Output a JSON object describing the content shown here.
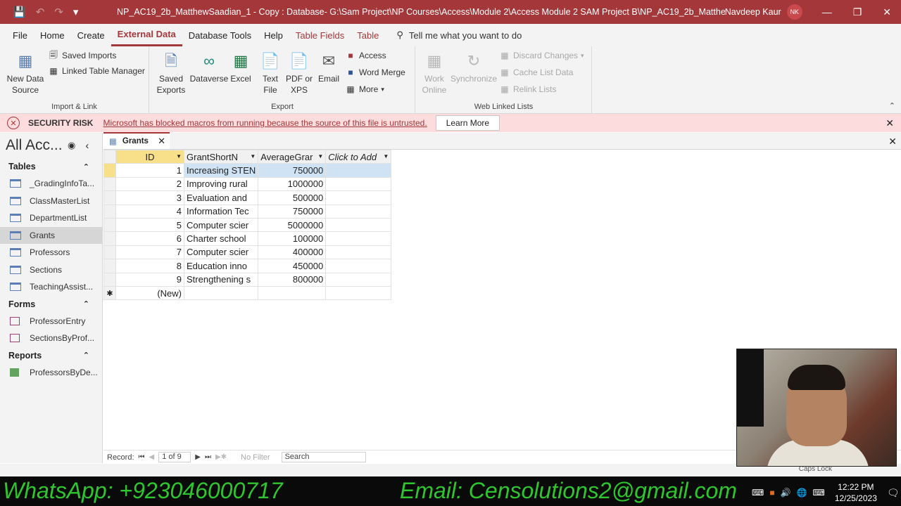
{
  "titlebar": {
    "title": "NP_AC19_2b_MatthewSaadian_1 - Copy : Database- G:\\Sam Project\\NP Courses\\Access\\Module 2\\Access Module 2 SAM Project B\\NP_AC19_2b_Matthew...",
    "user": "Navdeep Kaur",
    "initials": "NK"
  },
  "ribbon_tabs": [
    "File",
    "Home",
    "Create",
    "External Data",
    "Database Tools",
    "Help",
    "Table Fields",
    "Table"
  ],
  "active_tab": "External Data",
  "tell_me": "Tell me what you want to do",
  "ribbon": {
    "import_link": {
      "label": "Import & Link",
      "new_source": "New Data Source",
      "saved_imports": "Saved Imports",
      "linked_table_manager": "Linked Table Manager"
    },
    "export": {
      "label": "Export",
      "saved_exports": "Saved Exports",
      "dataverse": "Dataverse",
      "excel": "Excel",
      "text_file": "Text File",
      "pdf_xps": "PDF or XPS",
      "email": "Email",
      "access": "Access",
      "word_merge": "Word Merge",
      "more": "More"
    },
    "web_linked": {
      "label": "Web Linked Lists",
      "work_online": "Work Online",
      "synchronize": "Synchronize",
      "discard_changes": "Discard Changes",
      "cache_list_data": "Cache List Data",
      "relink_lists": "Relink Lists"
    }
  },
  "security": {
    "label": "SECURITY RISK",
    "message": "Microsoft has blocked macros from running because the source of this file is untrusted.",
    "button": "Learn More"
  },
  "nav": {
    "title": "All Acc...",
    "sections": {
      "tables": "Tables",
      "forms": "Forms",
      "reports": "Reports"
    },
    "tables": [
      "_GradingInfoTa...",
      "ClassMasterList",
      "DepartmentList",
      "Grants",
      "Professors",
      "Sections",
      "TeachingAssist..."
    ],
    "forms": [
      "ProfessorEntry",
      "SectionsByProf..."
    ],
    "reports": [
      "ProfessorsByDe..."
    ]
  },
  "document": {
    "tab": "Grants",
    "columns": [
      "ID",
      "GrantShortN",
      "AverageGrar",
      "Click to Add"
    ],
    "rows": [
      {
        "id": "1",
        "name": "Increasing STEN",
        "amount": "750000"
      },
      {
        "id": "2",
        "name": "Improving rural",
        "amount": "1000000"
      },
      {
        "id": "3",
        "name": "Evaluation and",
        "amount": "500000"
      },
      {
        "id": "4",
        "name": "Information Tec",
        "amount": "750000"
      },
      {
        "id": "5",
        "name": "Computer scier",
        "amount": "5000000"
      },
      {
        "id": "6",
        "name": "Charter school",
        "amount": "100000"
      },
      {
        "id": "7",
        "name": "Computer scier",
        "amount": "400000"
      },
      {
        "id": "8",
        "name": "Education inno",
        "amount": "450000"
      },
      {
        "id": "9",
        "name": "Strengthening s",
        "amount": "800000"
      }
    ],
    "new_row": "(New)"
  },
  "record_nav": {
    "label": "Record:",
    "position": "1 of 9",
    "no_filter": "No Filter",
    "search": "Search"
  },
  "status": {
    "caps_lock": "Caps Lock"
  },
  "banner": {
    "whatsapp": "WhatsApp: +923046000717",
    "email": "Email: Censolutions2@gmail.com"
  },
  "tray": {
    "time": "12:22 PM",
    "date": "12/25/2023"
  }
}
